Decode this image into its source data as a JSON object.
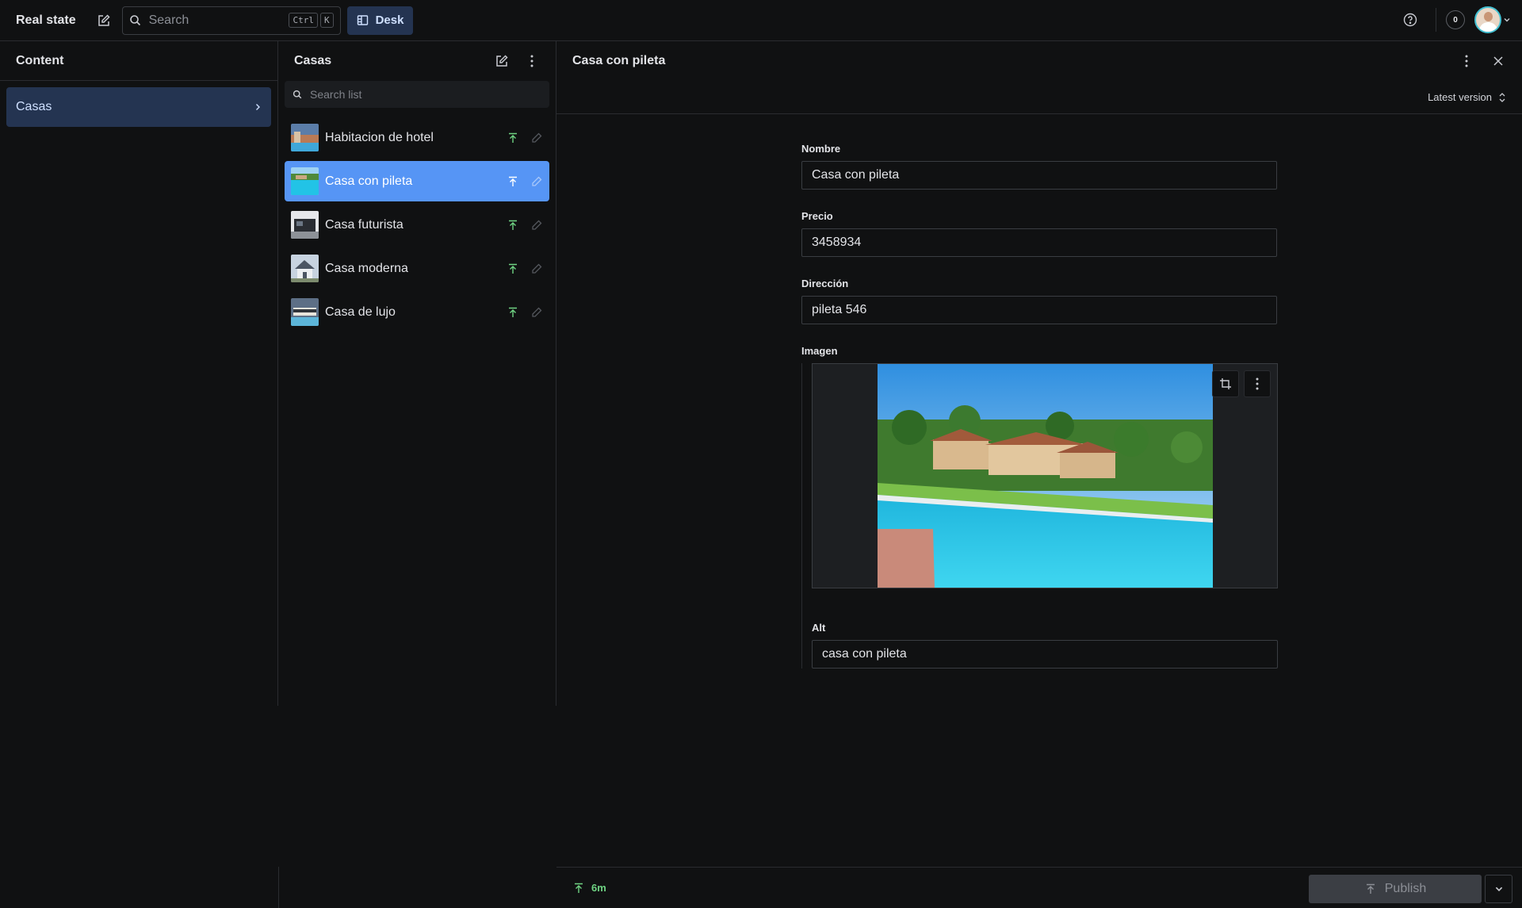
{
  "topbar": {
    "brand": "Real state",
    "search_placeholder": "Search",
    "shortcut_ctrl": "Ctrl",
    "shortcut_key": "K",
    "desk_label": "Desk",
    "notification_count": "0"
  },
  "content_pane": {
    "title": "Content",
    "items": [
      {
        "label": "Casas"
      }
    ]
  },
  "list_pane": {
    "title": "Casas",
    "search_placeholder": "Search list",
    "items": [
      {
        "label": "Habitacion de hotel",
        "selected": false
      },
      {
        "label": "Casa con pileta",
        "selected": true
      },
      {
        "label": "Casa futurista",
        "selected": false
      },
      {
        "label": "Casa moderna",
        "selected": false
      },
      {
        "label": "Casa de lujo",
        "selected": false
      }
    ]
  },
  "document": {
    "title": "Casa con pileta",
    "version_label": "Latest version",
    "fields": {
      "nombre": {
        "label": "Nombre",
        "value": "Casa con pileta"
      },
      "precio": {
        "label": "Precio",
        "value": "3458934"
      },
      "direccion": {
        "label": "Dirección",
        "value": "pileta 546"
      },
      "imagen": {
        "label": "Imagen"
      },
      "alt": {
        "label": "Alt",
        "value": "casa con pileta"
      }
    }
  },
  "footer": {
    "status_time": "6m",
    "publish_label": "Publish"
  },
  "colors": {
    "background": "#101112",
    "accent": "#5695f5",
    "nav_selected": "#243451",
    "published_green": "#6fd383"
  }
}
